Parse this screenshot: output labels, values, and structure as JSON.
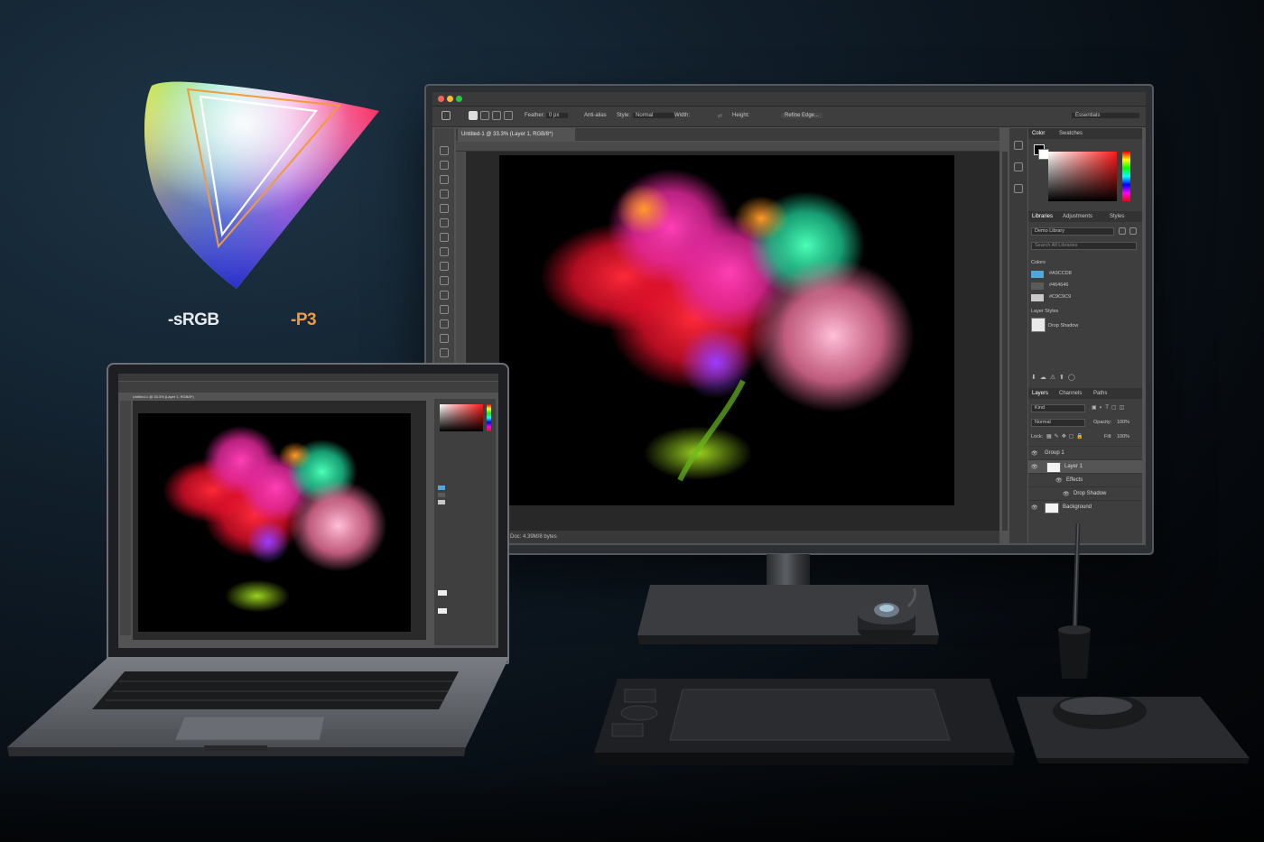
{
  "gamut": {
    "srgb_label": "-sRGB",
    "p3_label": "-P3",
    "srgb_color": "#e8eaee",
    "p3_color": "#f29a3c"
  },
  "monitor": {
    "document_tab": "Untitled-1 @ 33.3% (Layer 1, RGB/8*)",
    "options": {
      "feather_label": "Feather:",
      "feather_value": "0 px",
      "anti_alias": "Anti-alias",
      "style_label": "Style:",
      "style_value": "Normal",
      "width_label": "Width:",
      "height_label": "Height:",
      "refine_edge": "Refine Edge...",
      "workspace": "Essentials"
    },
    "status_text": "Doc: 4.39M/8 bytes",
    "panels": {
      "color_tab": "Color",
      "swatches_tab": "Swatches",
      "libraries_tab": "Libraries",
      "adjustments_tab": "Adjustments",
      "styles_tab": "Styles",
      "library_select": "Demo Library",
      "search_placeholder": "Search All Libraries",
      "colors_heading": "Colors",
      "colors": [
        {
          "label": "#A9CCD8",
          "hex": "#4fa7dc"
        },
        {
          "label": "#464646",
          "hex": "#5a5a5a"
        },
        {
          "label": "#C9C9C9",
          "hex": "#c9c9c9"
        }
      ],
      "layer_styles_heading": "Layer Styles",
      "drop_shadow_style": "Drop Shadow",
      "layers_tab": "Layers",
      "channels_tab": "Channels",
      "paths_tab": "Paths",
      "kind_select": "Kind",
      "blend_mode": "Normal",
      "opacity_label": "Opacity:",
      "opacity_value": "100%",
      "lock_label": "Lock:",
      "fill_label": "Fill:",
      "fill_value": "100%",
      "layers": [
        {
          "name": "Group 1"
        },
        {
          "name": "Layer 1"
        },
        {
          "name": "Effects"
        },
        {
          "name": "Drop Shadow"
        },
        {
          "name": "Background"
        }
      ]
    }
  },
  "laptop": {
    "document_tab": "Untitled-1 @ 33.3% (Layer 1, RGB/8*)"
  }
}
